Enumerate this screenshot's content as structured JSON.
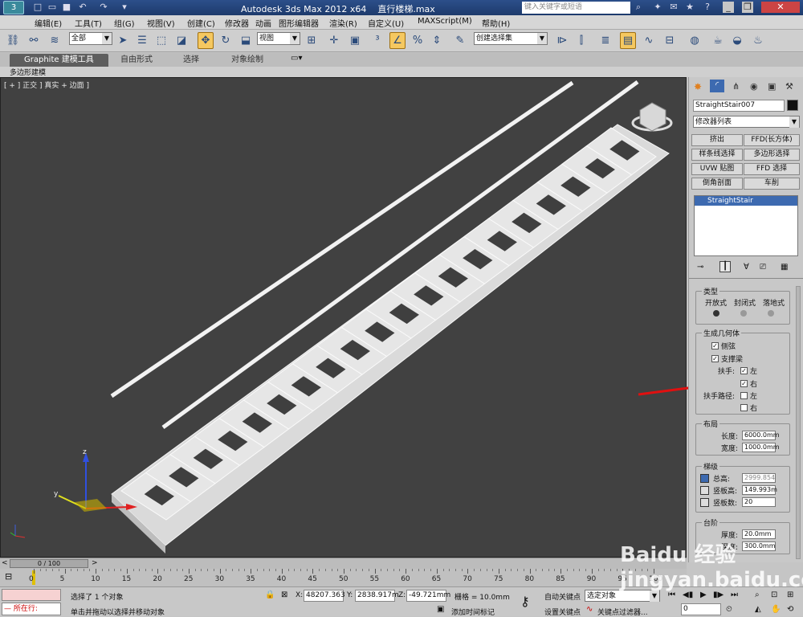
{
  "window": {
    "app_title": "Autodesk 3ds Max  2012 x64",
    "file_name": "直行楼梯.max",
    "search_placeholder": "键入关键字或短语",
    "logo_text": "3"
  },
  "menu": [
    "编辑(E)",
    "工具(T)",
    "组(G)",
    "视图(V)",
    "创建(C)",
    "修改器",
    "动画",
    "图形编辑器",
    "渲染(R)",
    "自定义(U)",
    "MAXScript(M)",
    "帮助(H)"
  ],
  "toolbar": {
    "filter_value": "全部",
    "ref_coord_value": "视图",
    "selection_set_value": "创建选择集"
  },
  "ribbon": {
    "tabs": [
      "Graphite 建模工具",
      "自由形式",
      "选择",
      "对象绘制"
    ],
    "active_tab": 0,
    "sub_label": "多边形建模"
  },
  "viewport": {
    "label": "[ + ] 正交 ] 真实 + 边面 ]"
  },
  "command_panel": {
    "object_name": "StraightStair007",
    "modifier_list": "修改器列表",
    "modifier_buttons": [
      "挤出",
      "FFD(长方体)",
      "样条线选择",
      "多边形选择",
      "UVW 贴图",
      "FFD 选择",
      "倒角剖面",
      "车削"
    ],
    "stack_items": [
      "StraightStair"
    ],
    "type_group": {
      "title": "类型",
      "options": [
        "开放式",
        "封闭式",
        "落地式"
      ]
    },
    "geometry_group": {
      "title": "生成几何体",
      "stringers_label": "侧弦",
      "carriage_label": "支撑梁",
      "handrail_label": "扶手:",
      "handrail_left": "左",
      "handrail_right": "右",
      "rail_path_label": "扶手路径:",
      "rail_path_left": "左",
      "rail_path_right": "右",
      "stringers_checked": true,
      "carriage_checked": true,
      "handrail_left_checked": true,
      "handrail_right_checked": true,
      "rail_path_left_checked": false,
      "rail_path_right_checked": false
    },
    "layout_group": {
      "title": "布局",
      "length_label": "长度:",
      "length_value": "6000.0mm",
      "width_label": "宽度:",
      "width_value": "1000.0mm"
    },
    "rise_group": {
      "title": "梯级",
      "overall_label": "总高:",
      "overall_value": "2999.854",
      "riser_ht_label": "竖板高:",
      "riser_ht_value": "149.993m",
      "riser_ct_label": "竖板数:",
      "riser_ct_value": "20"
    },
    "steps_group": {
      "title": "台阶",
      "thickness_label": "厚度:",
      "thickness_value": "20.0mm",
      "depth_label": "深度:",
      "depth_value": "300.0mm"
    }
  },
  "timeline": {
    "frame_display": "0 / 100",
    "ticks": [
      "0",
      "5",
      "10",
      "15",
      "20",
      "25",
      "30",
      "35",
      "40",
      "45",
      "50",
      "55",
      "60",
      "65",
      "70",
      "75",
      "80",
      "85",
      "90",
      "95",
      "100"
    ]
  },
  "status": {
    "maxscript_label": "所在行:",
    "selected_msg": "选择了 1 个对象",
    "prompt_msg": "单击并拖动以选择并移动对象",
    "x_label": "X:",
    "x_value": "48207.363",
    "y_label": "Y:",
    "y_value": "2838.917m",
    "z_label": "Z:",
    "z_value": "-49.721mm",
    "grid_text": "栅格 = 10.0mm",
    "add_time_tag": "添加时间标记",
    "auto_key": "自动关键点",
    "set_key": "设置关键点",
    "selected_value": "选定对象",
    "key_filters": "关键点过滤器...",
    "frame_value": "0"
  },
  "watermark": "Baidu 经验  jingyan.baidu.com"
}
